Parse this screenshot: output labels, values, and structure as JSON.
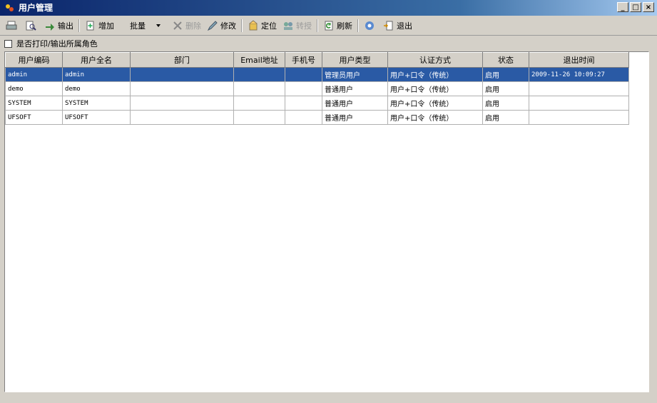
{
  "window": {
    "title": "用户管理",
    "min": "_",
    "max": "□",
    "close": "×"
  },
  "toolbar": {
    "items": [
      {
        "label": "",
        "icon": "print-icon"
      },
      {
        "label": "",
        "icon": "preview-icon"
      },
      {
        "label": "输出",
        "icon": "export-icon"
      },
      {
        "label": "增加",
        "icon": "add-icon"
      },
      {
        "label": "批量",
        "icon": "batch-dropdown"
      },
      {
        "label": "删除",
        "icon": "delete-icon"
      },
      {
        "label": "修改",
        "icon": "edit-icon"
      },
      {
        "label": "定位",
        "icon": "locate-icon"
      },
      {
        "label": "转授",
        "icon": "transfer-icon"
      },
      {
        "label": "刷新",
        "icon": "refresh-icon"
      },
      {
        "label": "",
        "icon": "help-icon"
      },
      {
        "label": "退出",
        "icon": "exit-icon"
      }
    ]
  },
  "option": {
    "label": "是否打印/输出所属角色",
    "checked": false
  },
  "table": {
    "headers": [
      "用户编码",
      "用户全名",
      "部门",
      "Email地址",
      "手机号",
      "用户类型",
      "认证方式",
      "状态",
      "退出时间"
    ],
    "rows": [
      [
        "admin",
        "admin",
        "",
        "",
        "",
        "管理员用户",
        "用户+口令（传统）",
        "启用",
        "2009-11-26 10:09:27"
      ],
      [
        "demo",
        "demo",
        "",
        "",
        "",
        "普通用户",
        "用户+口令（传统）",
        "启用",
        ""
      ],
      [
        "SYSTEM",
        "SYSTEM",
        "",
        "",
        "",
        "普通用户",
        "用户+口令（传统）",
        "启用",
        ""
      ],
      [
        "UFSOFT",
        "UFSOFT",
        "",
        "",
        "",
        "普通用户",
        "用户+口令（传统）",
        "启用",
        ""
      ]
    ]
  },
  "colors": {
    "selected_row": "#2a5aa5",
    "title_bar": "#0a246a"
  }
}
